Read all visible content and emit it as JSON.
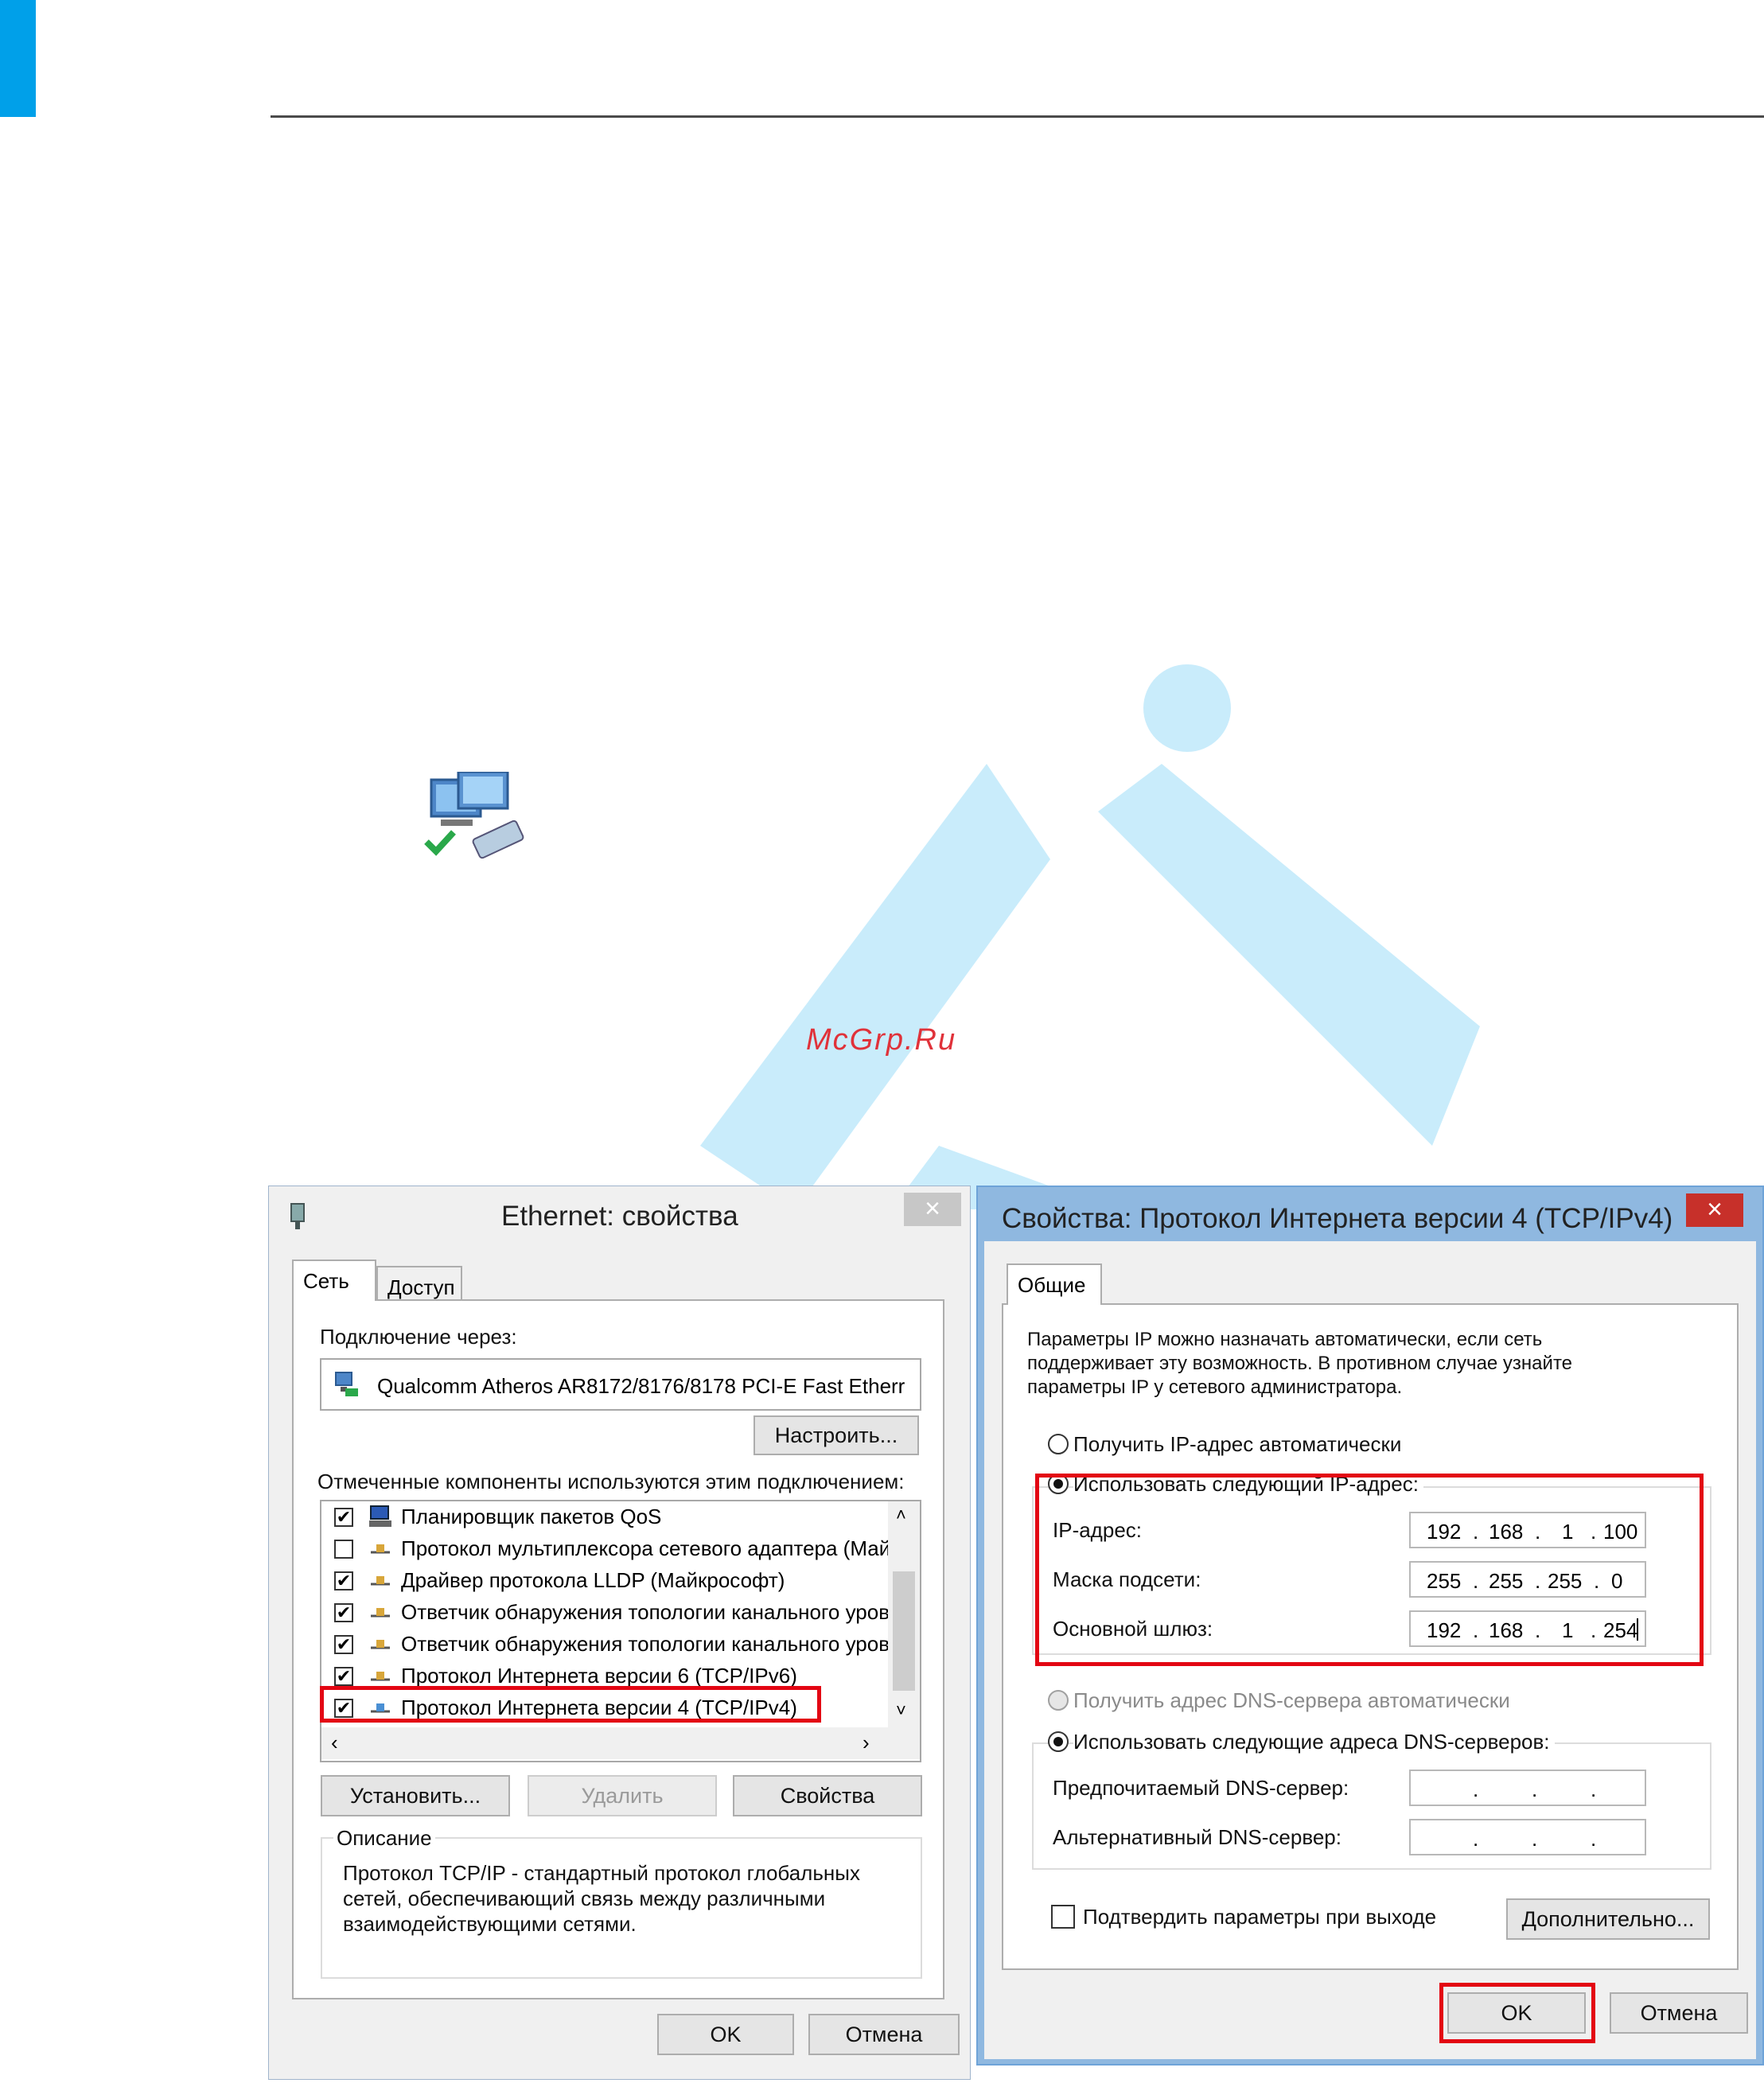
{
  "watermark": {
    "text": "McGrp.Ru"
  },
  "left_dialog": {
    "title": "Ethernet: свойства",
    "close": "×",
    "tabs": [
      {
        "label": "Сеть"
      },
      {
        "label": "Доступ"
      }
    ],
    "connect_via_label": "Подключение через:",
    "adapter_name": "Qualcomm Atheros AR8172/8176/8178 PCI-E Fast Etherr",
    "configure_button": "Настроить...",
    "components_label": "Отмеченные компоненты используются этим подключением:",
    "components": [
      {
        "label": "Планировщик пакетов QoS",
        "checked": "✔"
      },
      {
        "label": "Протокол мультиплексора сетевого адаптера (Май",
        "checked": ""
      },
      {
        "label": "Драйвер протокола LLDP (Майкрософт)",
        "checked": "✔"
      },
      {
        "label": "Ответчик обнаружения топологии канального уров",
        "checked": "✔"
      },
      {
        "label": "Ответчик обнаружения топологии канального уров",
        "checked": "✔"
      },
      {
        "label": "Протокол Интернета версии 6 (TCP/IPv6)",
        "checked": "✔"
      },
      {
        "label": "Протокол Интернета версии 4 (TCP/IPv4)",
        "checked": "✔"
      }
    ],
    "install_button": "Установить...",
    "remove_button": "Удалить",
    "properties_button": "Свойства",
    "description_label": "Описание",
    "description_text": [
      "Протокол TCP/IP - стандартный протокол глобальных",
      "сетей, обеспечивающий связь между различными",
      "взаимодействующими сетями."
    ],
    "ok_button": "OK",
    "cancel_button": "Отмена"
  },
  "right_dialog": {
    "title": "Свойства: Протокол Интернета версии 4 (TCP/IPv4)",
    "close": "×",
    "tab": "Общие",
    "info_text": [
      "Параметры IP можно назначать автоматически, если сеть",
      "поддерживает эту возможность. В противном случае узнайте",
      "параметры IP у сетевого администратора."
    ],
    "auto_ip_label": "Получить IP-адрес автоматически",
    "manual_ip_label": "Использовать следующий IP-адрес:",
    "ip_label": "IP-адрес:",
    "ip_value": [
      "192",
      "168",
      "1",
      "100"
    ],
    "mask_label": "Маска подсети:",
    "mask_value": [
      "255",
      "255",
      "255",
      "0"
    ],
    "gateway_label": "Основной шлюз:",
    "gateway_value": [
      "192",
      "168",
      "1",
      "254"
    ],
    "auto_dns_label": "Получить адрес DNS-сервера автоматически",
    "manual_dns_label": "Использовать следующие адреса DNS-серверов:",
    "preferred_dns_label": "Предпочитаемый DNS-сервер:",
    "alternate_dns_label": "Альтернативный DNS-сервер:",
    "dot": ".",
    "validate_label": "Подтвердить параметры при выходе",
    "advanced_button": "Дополнительно...",
    "ok_button": "OK",
    "cancel_button": "Отмена"
  }
}
